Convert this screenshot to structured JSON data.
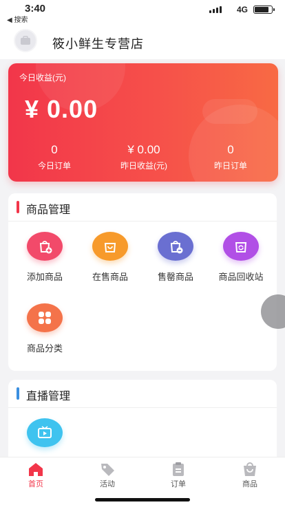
{
  "status_bar": {
    "time": "3:40",
    "back_label": "◀ 搜索",
    "network": "4G",
    "battery_level_fraction": 0.85
  },
  "header": {
    "shop_name": "筱小鲜生专营店"
  },
  "earnings": {
    "title": "今日收益(元)",
    "amount": "¥ 0.00",
    "stats": [
      {
        "value": "0",
        "label": "今日订单"
      },
      {
        "value": "¥ 0.00",
        "label": "昨日收益(元)"
      },
      {
        "value": "0",
        "label": "昨日订单"
      }
    ]
  },
  "goods_panel": {
    "title": "商品管理",
    "accent": "#f2364a",
    "items": [
      {
        "label": "添加商品",
        "icon": "bag-plus-icon",
        "color": "#f24a6a"
      },
      {
        "label": "在售商品",
        "icon": "bag-icon",
        "color": "#f79a2b"
      },
      {
        "label": "售罄商品",
        "icon": "bag-sold-out-icon",
        "color": "#6a6fd1"
      },
      {
        "label": "商品回收站",
        "icon": "bag-recycle-icon",
        "color": "#b14fe6"
      },
      {
        "label": "商品分类",
        "icon": "category-icon",
        "color": "#f4734a"
      }
    ]
  },
  "live_panel": {
    "title": "直播管理",
    "accent": "#3a8fe0",
    "items": [
      {
        "label": "",
        "icon": "tv-play-icon",
        "color": "#3fc3ef"
      }
    ]
  },
  "tabbar": {
    "active_color": "#f2364a",
    "inactive_color": "#b9b9bd",
    "items": [
      {
        "label": "首页",
        "icon": "home-icon"
      },
      {
        "label": "活动",
        "icon": "tag-icon"
      },
      {
        "label": "订单",
        "icon": "clipboard-icon"
      },
      {
        "label": "商品",
        "icon": "shop-bag-icon"
      }
    ]
  }
}
